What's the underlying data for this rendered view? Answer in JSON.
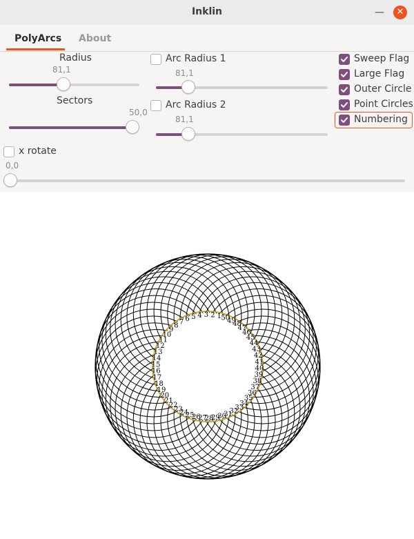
{
  "window": {
    "title": "Inklin",
    "accent": "#e95420",
    "check_color": "#7e4e7e"
  },
  "tabs": [
    {
      "label": "PolyArcs",
      "active": true
    },
    {
      "label": "About",
      "active": false
    }
  ],
  "controls": {
    "radius": {
      "label": "Radius",
      "value": "81,1",
      "fraction": 0.41
    },
    "sectors": {
      "label": "Sectors",
      "value": "50,0",
      "fraction": 1.0
    },
    "arc_radius_1": {
      "label": "Arc Radius 1",
      "value": "81,1",
      "fraction": 0.163,
      "checked": false
    },
    "arc_radius_2": {
      "label": "Arc Radius 2",
      "value": "81,1",
      "fraction": 0.163,
      "checked": false
    },
    "x_rotate": {
      "label": "x rotate",
      "value": "0,0",
      "fraction": 0.0,
      "checked": false
    }
  },
  "options": [
    {
      "label": "Sweep Flag",
      "checked": true
    },
    {
      "label": "Large Flag",
      "checked": true
    },
    {
      "label": "Outer Circle",
      "checked": true
    },
    {
      "label": "Point Circles",
      "checked": true
    },
    {
      "label": "Numbering",
      "checked": true,
      "focused": true
    }
  ],
  "drawing": {
    "sectors": 50,
    "numbering": [
      "1",
      "2",
      "3",
      "4",
      "5",
      "6",
      "7",
      "8",
      "9",
      "10",
      "11",
      "12",
      "13",
      "14",
      "15",
      "16",
      "17",
      "18",
      "19",
      "20",
      "21",
      "22",
      "23",
      "24",
      "25",
      "26",
      "27",
      "28",
      "29",
      "30",
      "31",
      "32",
      "33",
      "34",
      "35",
      "36",
      "37",
      "38",
      "39",
      "40",
      "41",
      "42",
      "43",
      "44",
      "45",
      "46",
      "47",
      "48",
      "49",
      "50"
    ]
  }
}
